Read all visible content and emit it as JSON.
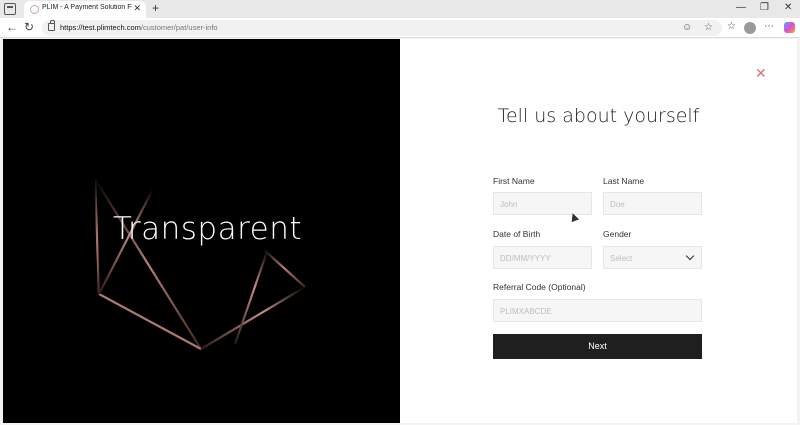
{
  "browser": {
    "tab_title": "PLIM - A Payment Solution For Th",
    "tab_close": "✕",
    "new_tab": "+",
    "url_host": "https://test.plimtech.com",
    "url_path": "/customer/pat/user-info",
    "window_controls": [
      "—",
      "❐",
      "✕"
    ]
  },
  "hero": {
    "title": "Transparent",
    "accent_color": "#b77f7a"
  },
  "form": {
    "close": "✕",
    "heading": "Tell us about yourself",
    "first_name": {
      "label": "First Name",
      "placeholder": "John"
    },
    "last_name": {
      "label": "Last Name",
      "placeholder": "Doe"
    },
    "dob": {
      "label": "Date of Birth",
      "placeholder": "DD/MM/YYYY"
    },
    "gender": {
      "label": "Gender",
      "placeholder": "Select"
    },
    "referral": {
      "label": "Referral Code (Optional)",
      "placeholder": "PLIMXABCDE"
    },
    "next_label": "Next"
  },
  "colors": {
    "button_bg": "#1f1f1f",
    "field_bg": "#f6f6f6",
    "close_color": "#c77a7a"
  }
}
